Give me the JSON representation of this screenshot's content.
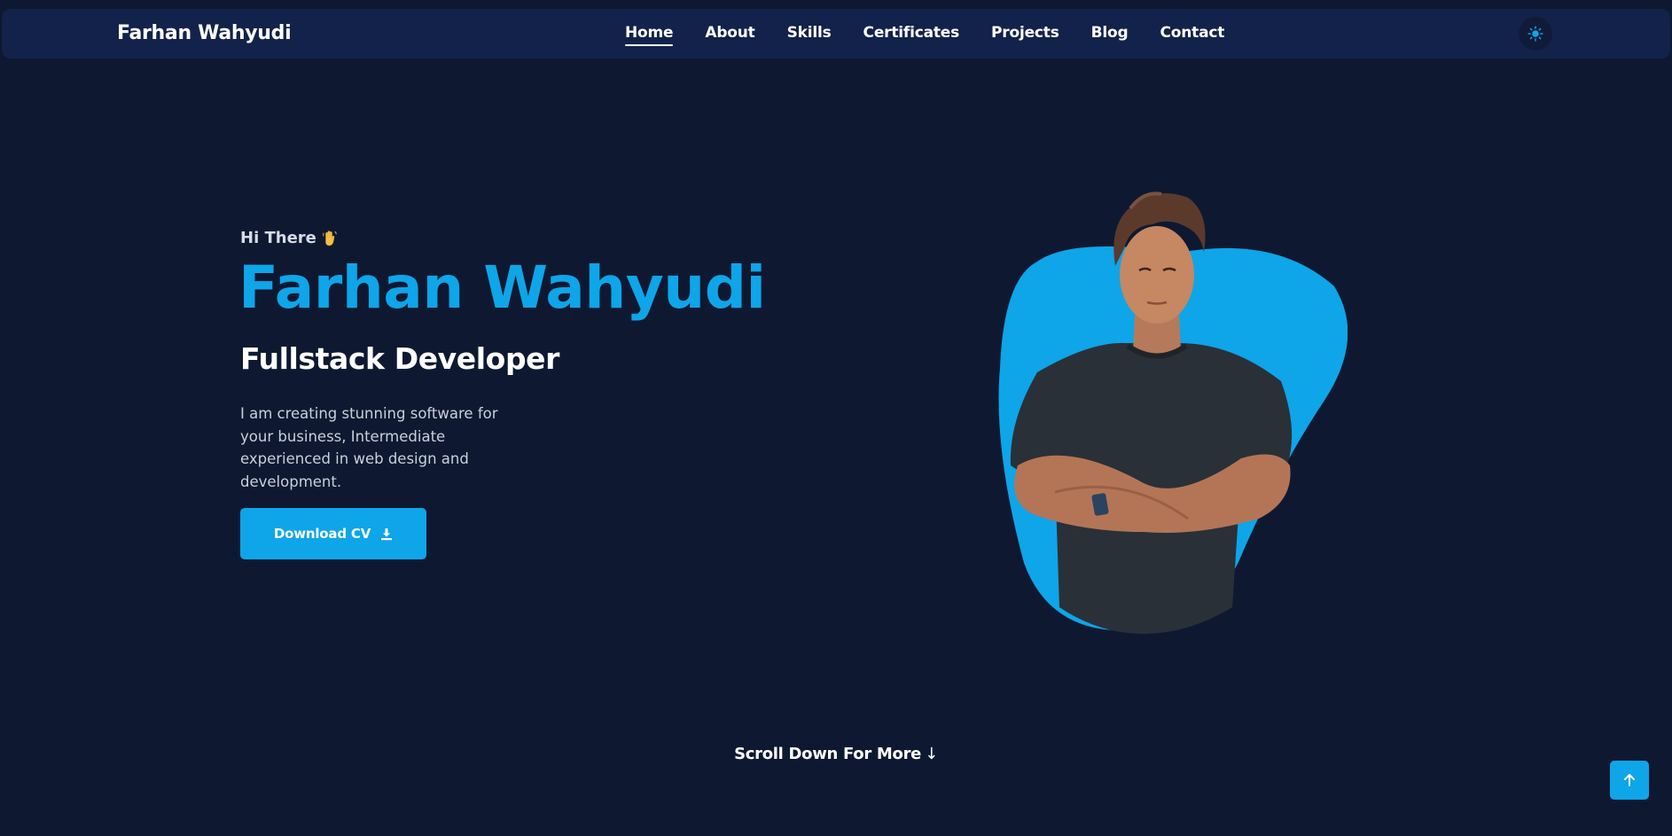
{
  "navbar": {
    "brand": "Farhan Wahyudi",
    "links": [
      {
        "label": "Home",
        "active": true
      },
      {
        "label": "About"
      },
      {
        "label": "Skills"
      },
      {
        "label": "Certificates"
      },
      {
        "label": "Projects"
      },
      {
        "label": "Blog"
      },
      {
        "label": "Contact"
      }
    ],
    "theme_toggle_icon": "sun-icon"
  },
  "hero": {
    "greeting": "Hi There",
    "greeting_icon": "waving-hand-icon",
    "name": "Farhan Wahyudi",
    "role": "Fullstack Developer",
    "description": "I am creating stunning software for your business, Intermediate experienced in web design and development.",
    "download_label": "Download CV",
    "download_icon": "download-icon"
  },
  "scroll_hint": {
    "label": "Scroll Down For More",
    "arrow": "↓"
  },
  "back_to_top_icon": "arrow-up-icon",
  "colors": {
    "background": "#0e1931",
    "navbar": "#13224a",
    "accent": "#0ea5e9",
    "text": "#ffffff",
    "muted_text": "#c9cfdc"
  }
}
